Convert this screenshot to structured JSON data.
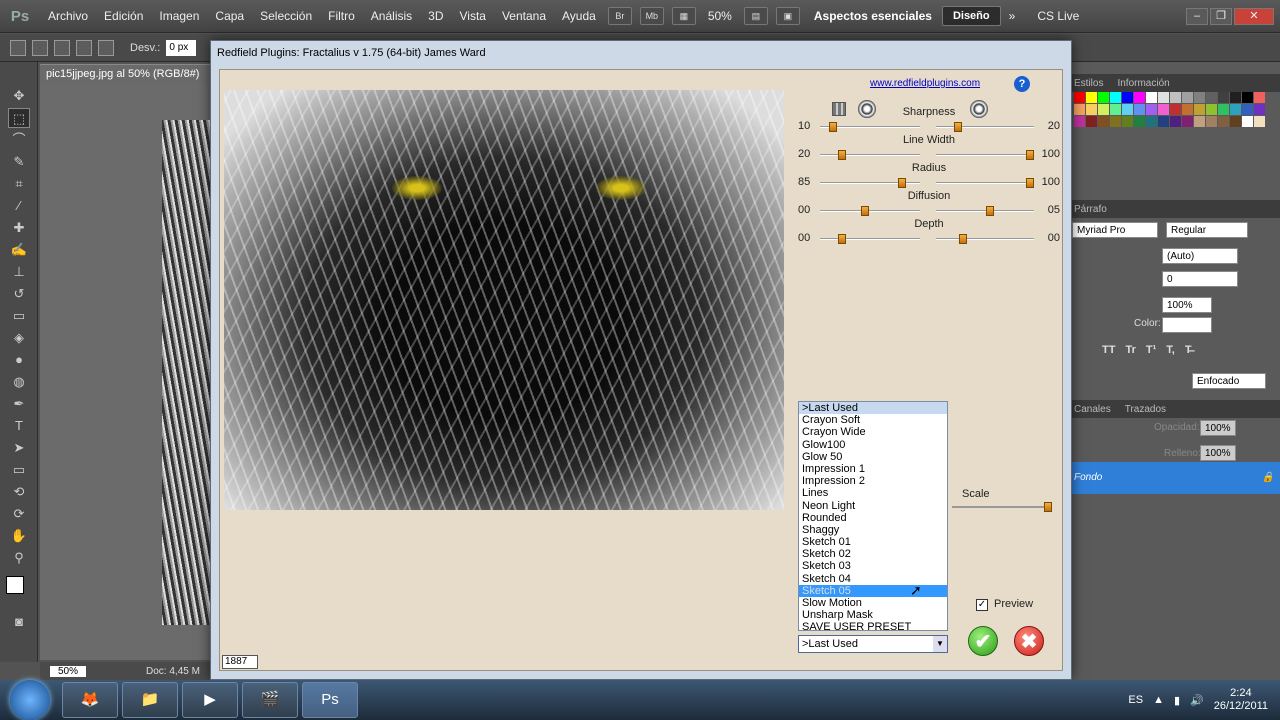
{
  "photoshop": {
    "logo": "Ps",
    "menu": [
      "Archivo",
      "Edición",
      "Imagen",
      "Capa",
      "Selección",
      "Filtro",
      "Análisis",
      "3D",
      "Vista",
      "Ventana",
      "Ayuda"
    ],
    "menubar_buttons": [
      "Br",
      "Mb"
    ],
    "zoom_menu": "50%",
    "workspace": "Aspectos esenciales",
    "diseno": "Diseño",
    "more": "»",
    "cslive": "CS Live",
    "options": {
      "desv_label": "Desv.:",
      "desv_value": "0 px"
    },
    "doc_tab": "pic15jjpeg.jpg al 50% (RGB/8#)",
    "status": {
      "zoom": "50%",
      "doc": "Doc: 4,45 M"
    }
  },
  "panels": {
    "tabs_top": [
      "Estilos",
      "Información"
    ],
    "tab_char": "Párrafo",
    "font_family": "Myriad Pro",
    "font_style": "Regular",
    "leading": "(Auto)",
    "tracking": "0",
    "scale": "100%",
    "color_label": "Color:",
    "anti_alias": "Enfocado",
    "tabs_layers": [
      "Canales",
      "Trazados"
    ],
    "opacity_label": "Opacidad:",
    "opacity": "100%",
    "fill_label": "Relleno:",
    "fill": "100%",
    "layer_name": "Fondo",
    "type_buttons": [
      "TT",
      "Tr",
      "T¹",
      "T,",
      "T̶"
    ],
    "swatch_colors": [
      "#ff0000",
      "#ffff00",
      "#00ff00",
      "#00ffff",
      "#0000ff",
      "#ff00ff",
      "#ffffff",
      "#e0e0e0",
      "#c0c0c0",
      "#a0a0a0",
      "#808080",
      "#606060",
      "#404040",
      "#202020",
      "#000000",
      "#f06060",
      "#f7a060",
      "#f9d060",
      "#d0f060",
      "#60f090",
      "#60d0f0",
      "#6090f0",
      "#a060f0",
      "#f060d0",
      "#c03030",
      "#c07030",
      "#c0a030",
      "#90c030",
      "#30c060",
      "#30a0c0",
      "#3060c0",
      "#7030c0",
      "#c030a0",
      "#802020",
      "#805020",
      "#807020",
      "#608020",
      "#208040",
      "#207080",
      "#204080",
      "#502080",
      "#802070",
      "#c0a080",
      "#a08060",
      "#806040",
      "#604020",
      "#ffffff",
      "#f0e0c0"
    ]
  },
  "dialog": {
    "title": "Redfield Plugins: Fractalius v 1.75 (64-bit)   James Ward",
    "url": "www.redfieldplugins.com",
    "help": "?",
    "dimension": "1887",
    "sliders": [
      {
        "label": "Sharpness",
        "left": "10",
        "right": "20",
        "v1": 0.1,
        "v2": 0.2
      },
      {
        "label": "Line Width",
        "left": "20",
        "right": "100",
        "v1": 0.2,
        "v2": 1.0
      },
      {
        "label": "Radius",
        "left": "85",
        "right": "100",
        "v1": 0.85,
        "v2": 1.0
      },
      {
        "label": "Diffusion",
        "left": "00",
        "right": "05",
        "v1": 0.45,
        "v2": 0.55
      },
      {
        "label": "Depth",
        "left": "00",
        "right": "00",
        "v1": 0.2,
        "v2": 0.25
      }
    ],
    "presets": [
      ">Last Used",
      "Crayon Soft",
      "Crayon Wide",
      "Glow100",
      "Glow 50",
      "Impression 1",
      "Impression 2",
      "Lines",
      "Neon Light",
      "Rounded",
      "Shaggy",
      "Sketch 01",
      "Sketch 02",
      "Sketch 03",
      "Sketch 04",
      "Sketch 05",
      "Slow Motion",
      "Unsharp Mask",
      "SAVE USER PRESET"
    ],
    "highlighted_preset": "Sketch 05",
    "selected_preset": ">Last Used",
    "scale_label": "Scale",
    "scale_value": 1.0,
    "preview_label": "Preview",
    "preview_checked": true
  },
  "taskbar": {
    "lang": "ES",
    "time": "2:24",
    "date": "26/12/2011",
    "apps": [
      "firefox-icon",
      "explorer-icon",
      "media-player-icon",
      "film-icon",
      "photoshop-icon"
    ],
    "ps_label": "Ps"
  }
}
